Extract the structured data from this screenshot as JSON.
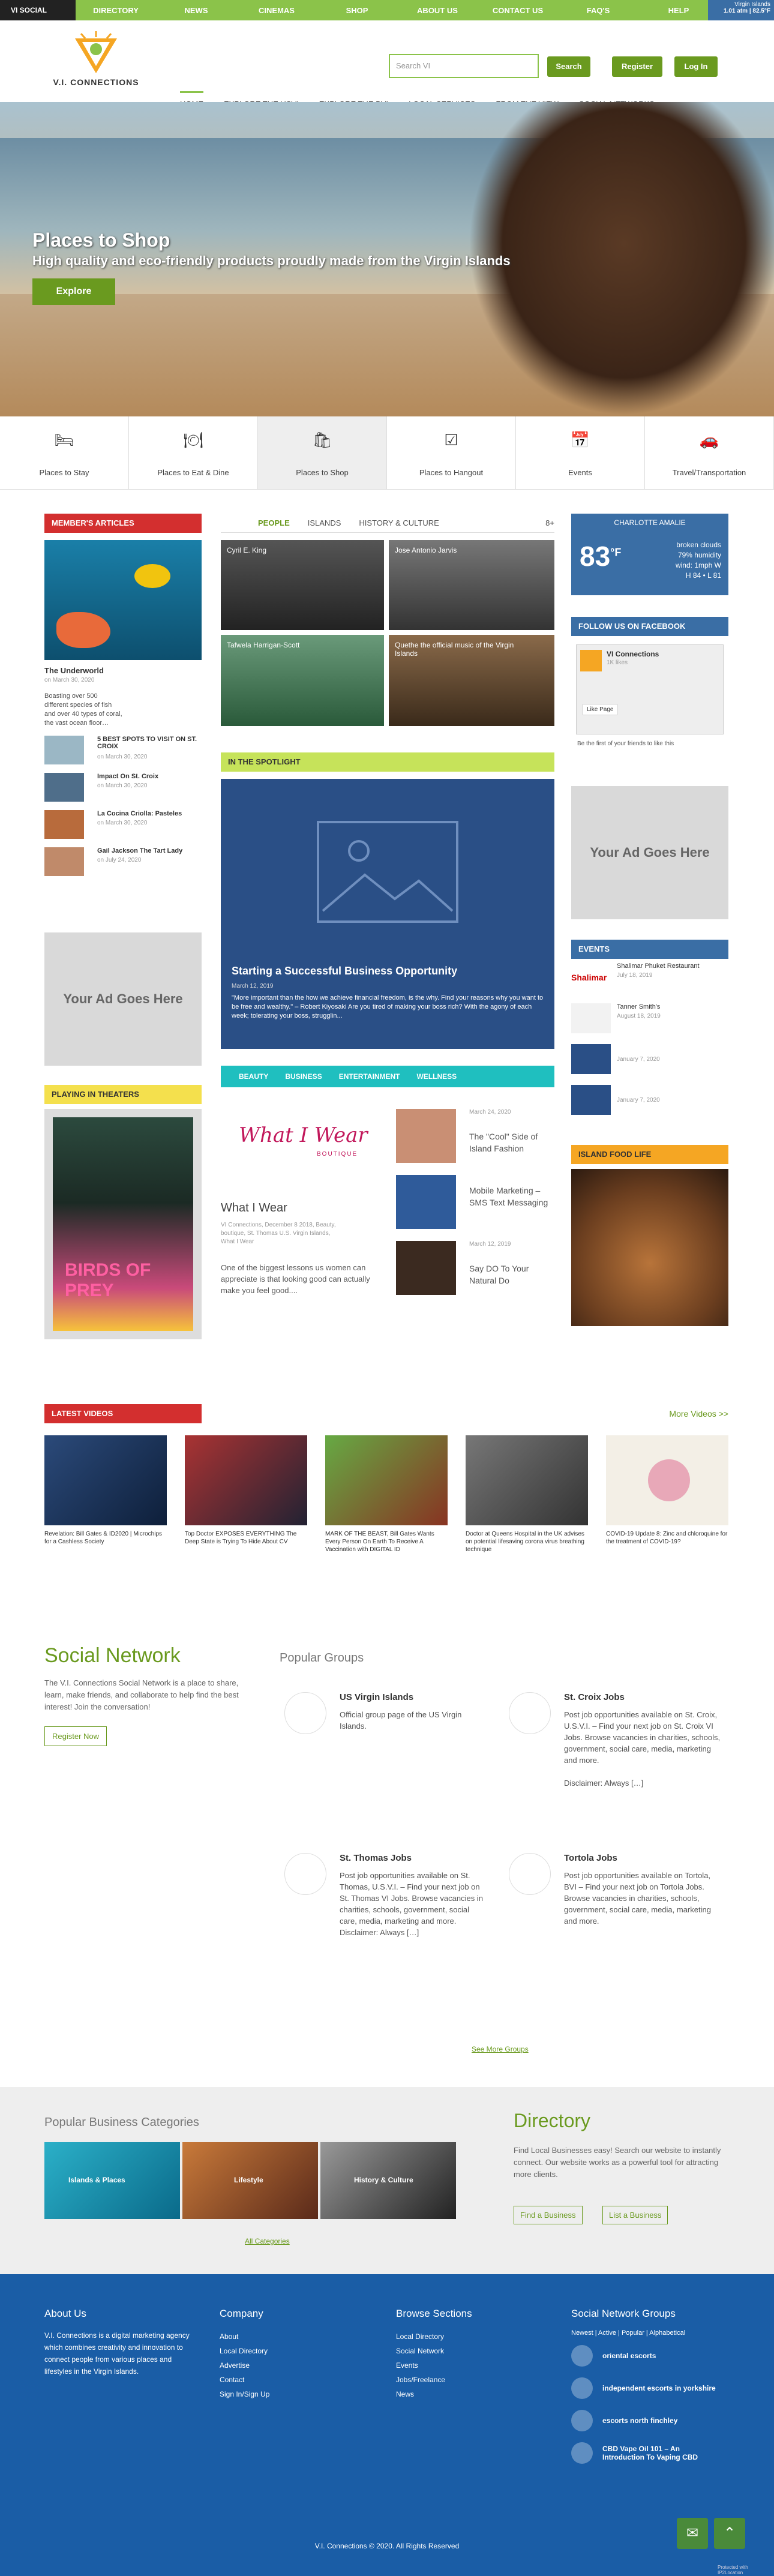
{
  "topbar": {
    "guide": "VI SOCIAL GUIDE",
    "links": [
      "DIRECTORY",
      "NEWS",
      "CINEMAS",
      "SHOP",
      "ABOUT US",
      "CONTACT US",
      "FAQ'S",
      "HELP"
    ],
    "weather_place": "Virgin Islands",
    "weather_val": "1.01 atm | 82.5°F"
  },
  "header": {
    "logo_name": "V.I. CONNECTIONS",
    "search_placeholder": "Search VI",
    "search_btn": "Search",
    "register_btn": "Register",
    "login_btn": "Log In"
  },
  "nav": [
    "HOME",
    "EXPLORE THE USVI",
    "EXPLORE THE BVI",
    "LOCAL SERVICES",
    "FROM THE VIEW",
    "SOCIAL NETWORKS"
  ],
  "hero": {
    "title": "Places to Shop",
    "subtitle": "High quality and eco-friendly products proudly made from the Virgin Islands",
    "cta": "Explore"
  },
  "categories": [
    "Places to Stay",
    "Places to Eat & Dine",
    "Places to Shop",
    "Places to Hangout",
    "Events",
    "Travel/Transportation"
  ],
  "members": {
    "title": "MEMBER'S ARTICLES",
    "feature_title": "The Underworld",
    "feature_date": "on March 30, 2020",
    "feature_text": "Boasting over 500 different species of fish and over 40 types of coral, the vast ocean floor…",
    "items": [
      {
        "t": "5 BEST SPOTS TO VISIT ON ST. CROIX",
        "d": "on March 30, 2020"
      },
      {
        "t": "Impact On St. Croix",
        "d": "on March 30, 2020"
      },
      {
        "t": "La Cocina Criolla: Pasteles",
        "d": "on March 30, 2020"
      },
      {
        "t": "Gail Jackson The Tart Lady",
        "d": "on July 24, 2020"
      }
    ]
  },
  "people": {
    "tabs": [
      "PEOPLE",
      "ISLANDS",
      "HISTORY & CULTURE"
    ],
    "more": "8+",
    "cells": [
      "Cyril E. King",
      "Jose Antonio Jarvis",
      "Tafwela Harrigan-Scott",
      "Quethe the official music of the Virgin Islands"
    ]
  },
  "weather_widget": {
    "city": "CHARLOTTE AMALIE",
    "temp": "83",
    "unit": "°F",
    "desc": "broken clouds",
    "humidity": "79% humidity",
    "wind": "wind: 1mph W",
    "hilo": "H 84 • L 81"
  },
  "facebook": {
    "title": "FOLLOW US ON FACEBOOK",
    "page": "VI Connections",
    "likes": "1K likes",
    "like_btn": "Like Page",
    "friends": "Be the first of your friends to like this"
  },
  "spotlight": {
    "title": "IN THE SPOTLIGHT",
    "headline": "Starting a Successful Business Opportunity",
    "date": "March 12, 2019",
    "text": "\"More important than the how we achieve financial freedom, is the why. Find your reasons why you want to be free and wealthy.\" – Robert Kiyosaki Are you tired of making your boss rich? With the agony of each week; tolerating your boss, strugglin..."
  },
  "ad": {
    "text": "Your Ad Goes Here"
  },
  "events": {
    "title": "EVENTS",
    "items": [
      {
        "t": "Shalimar Phuket Restaurant",
        "d": "July 18, 2019"
      },
      {
        "t": "Tanner Smith's",
        "d": "August 18, 2019"
      },
      {
        "t": "",
        "d": "January 7, 2020"
      },
      {
        "t": "",
        "d": "January 7, 2020"
      }
    ]
  },
  "beauty": {
    "tabs": [
      "BEAUTY",
      "BUSINESS",
      "ENTERTAINMENT",
      "WELLNESS"
    ],
    "feature_logo": "What I Wear",
    "feature_logo_sub": "BOUTIQUE",
    "feature_title": "What I Wear",
    "feature_meta": "VI Connections, December 8 2018, Beauty, boutique, St. Thomas U.S. Virgin Islands, What I Wear",
    "feature_text": "One of the biggest lessons us women can appreciate is that looking good can actually make you feel good....",
    "items": [
      {
        "d": "March 24, 2020",
        "t": "The \"Cool\" Side of Island Fashion"
      },
      {
        "d": "",
        "t": "Mobile Marketing – SMS Text Messaging"
      },
      {
        "d": "March 12, 2019",
        "t": "Say DO To Your Natural Do"
      }
    ]
  },
  "theaters": {
    "title": "PLAYING IN THEATERS",
    "movie": "BIRDS OF PREY"
  },
  "foodlife": {
    "title": "ISLAND FOOD LIFE"
  },
  "videos": {
    "title": "LATEST VIDEOS",
    "more": "More Videos >>",
    "items": [
      "Revelation: Bill Gates & ID2020 | Microchips for a Cashless Society",
      "Top Doctor EXPOSES EVERYTHING The Deep State is Trying To Hide About CV",
      "MARK OF THE BEAST, Bill Gates Wants Every Person On Earth To Receive A Vaccination with DIGITAL ID",
      "Doctor at Queens Hospital in the UK advises on potential lifesaving corona virus breathing technique",
      "COVID-19 Update 8: Zinc and chloroquine for the treatment of COVID-19?"
    ]
  },
  "social": {
    "title": "Social Network",
    "text": "The V.I. Connections Social Network is a place to share, learn, make friends, and collaborate to help find the best interest! Join the conversation!",
    "register": "Register Now",
    "groups_title": "Popular Groups",
    "groups": [
      {
        "n": "US Virgin Islands",
        "d": "Official group page of the US Virgin Islands."
      },
      {
        "n": "St. Croix Jobs",
        "d": "Post job opportunities available on St. Croix, U.S.V.I. – Find your next job on St. Croix VI Jobs. Browse vacancies in charities, schools, government, social care, media, marketing and more.\n\nDisclaimer: Always […]"
      },
      {
        "n": "St. Thomas Jobs",
        "d": "Post job opportunities available on St. Thomas, U.S.V.I. – Find your next job on St. Thomas VI Jobs. Browse vacancies in charities, schools, government, social care, media, marketing and more. Disclaimer: Always […]"
      },
      {
        "n": "Tortola Jobs",
        "d": "Post job opportunities available on Tortola, BVI – Find your next job on Tortola Jobs. Browse vacancies in charities, schools, government, social care, media, marketing and more."
      }
    ],
    "see_more": "See More Groups"
  },
  "business": {
    "title": "Popular Business Categories",
    "tiles": [
      "Islands & Places",
      "Lifestyle",
      "History & Culture"
    ],
    "all": "All Categories"
  },
  "directory": {
    "title": "Directory",
    "text": "Find Local Businesses easy! Search our website to instantly connect. Our website works as a powerful tool for attracting more clients.",
    "btn1": "Find a Business",
    "btn2": "List a Business"
  },
  "footer": {
    "about_title": "About Us",
    "about_text": "V.I. Connections is a digital marketing agency which combines creativity and innovation to connect people from various places and lifestyles in the Virgin Islands.",
    "company_title": "Company",
    "company": [
      "About",
      "Local Directory",
      "Advertise",
      "Contact",
      "Sign In/Sign Up"
    ],
    "browse_title": "Browse Sections",
    "browse": [
      "Local Directory",
      "Social Network",
      "Events",
      "Jobs/Freelance",
      "News"
    ],
    "groups_title": "Social Network Groups",
    "groups_tabs": "Newest | Active | Popular | Alphabetical",
    "groups": [
      "oriental escorts",
      "independent escorts in yorkshire",
      "escorts north finchley",
      "CBD Vape Oil 101 – An Introduction To Vaping CBD"
    ],
    "copyright": "V.I. Connections © 2020. All Rights Reserved",
    "badge": "Protected with IP2Location"
  },
  "colors": {
    "green": "#8bc34a",
    "dark_green": "#6a9a1f",
    "red": "#d32f2f",
    "blue": "#1a5da6",
    "teal": "#1fbfbf",
    "yellow": "#f4e04d",
    "lime": "#c6e35a",
    "orange": "#f5a623"
  }
}
